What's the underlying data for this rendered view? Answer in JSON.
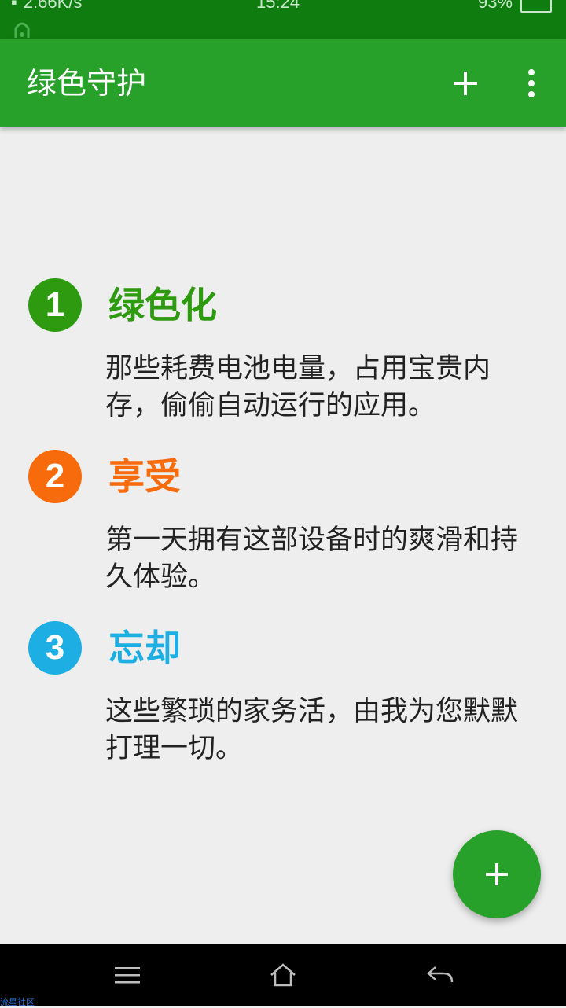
{
  "status_bar": {
    "network_speed": "2.66K/s",
    "time": "15:24",
    "battery": "93%"
  },
  "app_bar": {
    "title": "绿色守护",
    "add_icon": "plus-icon",
    "more_icon": "more-vert-icon"
  },
  "steps": [
    {
      "number": "1",
      "title": "绿色化",
      "description": "那些耗费电池电量，占用宝贵内存，偷偷自动运行的应用。",
      "color": "#2e9a10"
    },
    {
      "number": "2",
      "title": "享受",
      "description": "第一天拥有这部设备时的爽滑和持久体验。",
      "color": "#f76b0c"
    },
    {
      "number": "3",
      "title": "忘却",
      "description": "这些繁琐的家务活，由我为您默默打理一切。",
      "color": "#1daee3"
    }
  ],
  "fab": {
    "icon": "plus-icon"
  },
  "nav_bar": {
    "menu_icon": "menu-icon",
    "home_icon": "home-icon",
    "back_icon": "back-icon"
  },
  "watermark": "流星社区",
  "colors": {
    "status_bar": "#0f7c10",
    "app_bar": "#27a12a",
    "background": "#eeeeee"
  }
}
